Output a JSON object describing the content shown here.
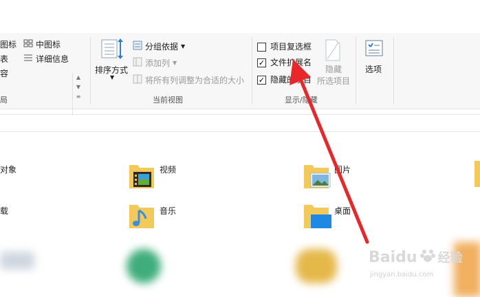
{
  "ribbon": {
    "layout_group": {
      "items": [
        "图标",
        "表",
        "容"
      ],
      "items2": [
        "中图标",
        "详细信息"
      ],
      "label": "局"
    },
    "current_view": {
      "sort_label": "排序方式",
      "group_by": "分组依据",
      "add_column": "添加列",
      "fit_columns": "将所有列调整为合适的大小",
      "label": "当前视图"
    },
    "show_hide": {
      "item_checkbox": "项目复选框",
      "file_ext": "文件扩展名",
      "hidden_items": "隐藏的项目",
      "hide_selected_line1": "隐藏",
      "hide_selected_line2": "所选项目",
      "label": "显示/隐藏",
      "checked": [
        false,
        true,
        true
      ]
    },
    "options": {
      "label": "选项"
    }
  },
  "folders": [
    {
      "label": "对象"
    },
    {
      "label": "视频"
    },
    {
      "label": "图片"
    },
    {
      "label": "载"
    },
    {
      "label": "音乐"
    },
    {
      "label": "桌面"
    }
  ],
  "watermark": {
    "brand": "Baidu",
    "cn": "经验",
    "url": "jingyan.baidu.com"
  },
  "colors": {
    "arrow": "#e8272b",
    "folder": "#f3c95a",
    "folder_dark": "#e2b13f"
  }
}
